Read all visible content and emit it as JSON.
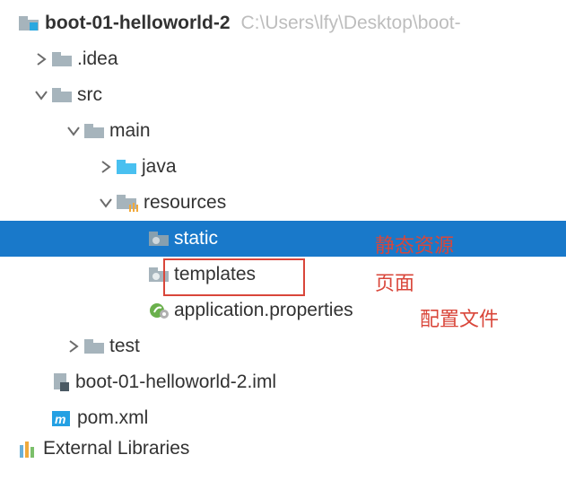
{
  "root": {
    "name": "boot-01-helloworld-2",
    "path": "C:\\Users\\lfy\\Desktop\\boot-"
  },
  "nodes": {
    "idea": ".idea",
    "src": "src",
    "main": "main",
    "java": "java",
    "resources": "resources",
    "static": "static",
    "templates": "templates",
    "appprops": "application.properties",
    "test": "test",
    "iml": "boot-01-helloworld-2.iml",
    "pom": "pom.xml",
    "extlib": "External Libraries"
  },
  "annotations": {
    "static": "静态资源",
    "templates": "页面",
    "appprops": "配置文件"
  },
  "colors": {
    "selection": "#1979ca",
    "folder_gray": "#a6b4bc",
    "folder_blue": "#2aa8e0",
    "annot_red": "#d9463a"
  }
}
